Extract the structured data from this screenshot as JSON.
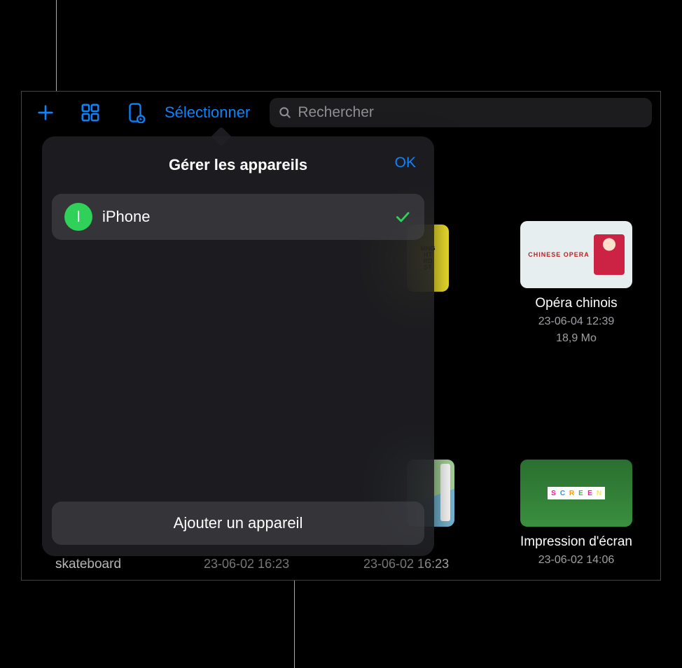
{
  "toolbar": {
    "select_label": "Sélectionner"
  },
  "search": {
    "placeholder": "Rechercher"
  },
  "popover": {
    "title": "Gérer les appareils",
    "done_label": "OK",
    "device": {
      "initial": "I",
      "name": "iPhone"
    },
    "add_device_label": "Ajouter un appareil"
  },
  "items": {
    "opera": {
      "title": "Opéra chinois",
      "date": "23-06-04 12:39",
      "size": "18,9 Mo",
      "thumb_text": "CHINESE OPERA"
    },
    "screen": {
      "title": "Impression d'écran",
      "date": "23-06-02 14:06"
    },
    "skateboard": {
      "title": "skateboard",
      "date": "23-06-02 16:23"
    },
    "city": {
      "date": "23-06-02 16:23"
    }
  }
}
